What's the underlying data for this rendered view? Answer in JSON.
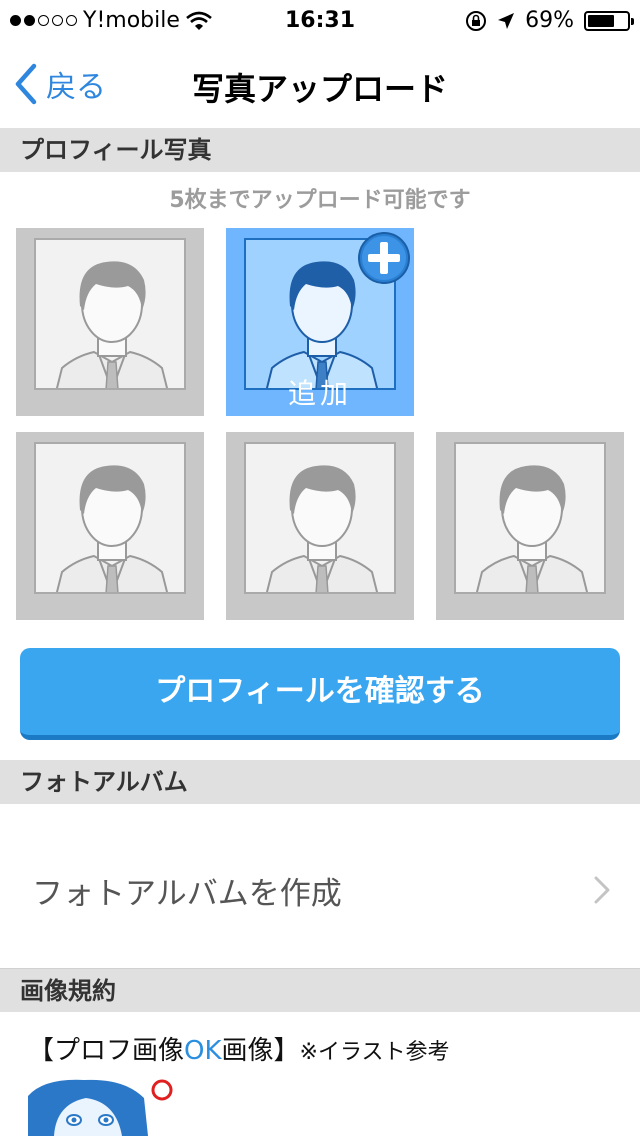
{
  "status_bar": {
    "carrier": "Y!mobile",
    "time": "16:31",
    "battery_percent": "69%",
    "battery_level": 0.69,
    "signal_bars_filled": 2,
    "signal_bars_total": 5
  },
  "nav": {
    "back_label": "戻る",
    "title": "写真アップロード"
  },
  "profile_section": {
    "header": "プロフィール写真",
    "upload_note": "5枚までアップロード可能です",
    "add_label": "追加"
  },
  "confirm_button": "プロフィールを確認する",
  "album_section": {
    "header": "フォトアルバム",
    "create_label": "フォトアルバムを作成"
  },
  "terms_section": {
    "header": "画像規約",
    "example_prefix": "【プロフ画像",
    "example_ok": "OK",
    "example_suffix": "画像】",
    "example_note": "※イラスト参考"
  },
  "colors": {
    "accent": "#3aa6f0",
    "link": "#2e86de",
    "add_tile": "#6fb6ff",
    "section_bg": "#e0e0e0"
  }
}
